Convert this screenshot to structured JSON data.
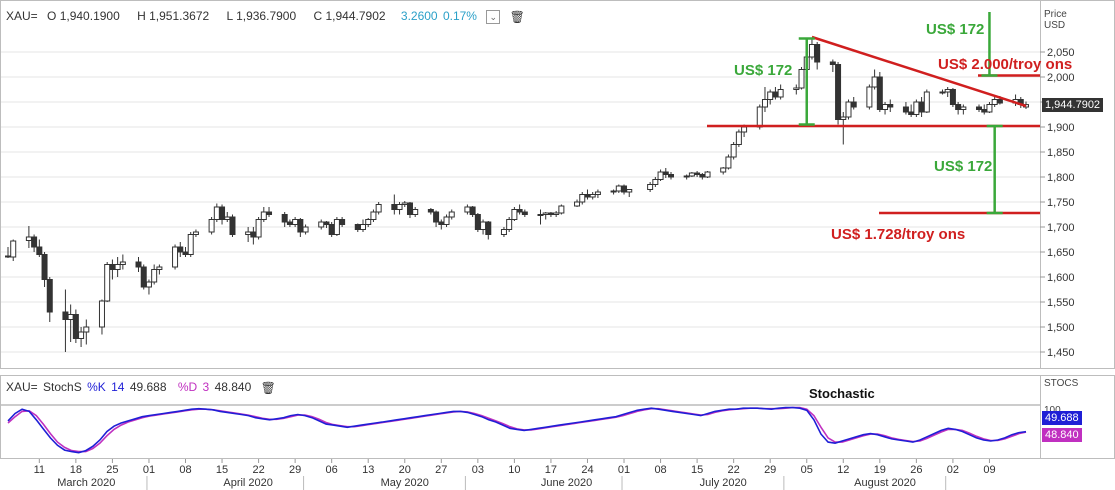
{
  "header": {
    "symbol": "XAU=",
    "open": "O 1,940.1900",
    "high": "H 1,951.3672",
    "low": "L 1,936.7900",
    "close": "C 1,944.7902",
    "change": "3.2600",
    "change_pct": "0.17%"
  },
  "stoch_header": {
    "symbol": "XAU=",
    "name": "StochS",
    "k_label": "%K",
    "k_period": "14",
    "k_value": "49.688",
    "d_label": "%D",
    "d_period": "3",
    "d_value": "48.840"
  },
  "price_axis": {
    "title_line1": "Price",
    "title_line2": "USD",
    "ticks": [
      "2,050",
      "2,000",
      "1,950",
      "1,900",
      "1,850",
      "1,800",
      "1,750",
      "1,700",
      "1,650",
      "1,600",
      "1,550",
      "1,500",
      "1,450"
    ],
    "last_price_label": "1,944.7902"
  },
  "stoch_axis": {
    "title": "STOCS",
    "tick": "100"
  },
  "x_axis": {
    "day_ticks": [
      "11",
      "18",
      "25",
      "01",
      "08",
      "15",
      "22",
      "29",
      "06",
      "13",
      "20",
      "27",
      "03",
      "10",
      "17",
      "24",
      "01",
      "08",
      "15",
      "22",
      "29",
      "05",
      "12",
      "19",
      "26",
      "02",
      "09"
    ],
    "month_labels": [
      "March 2020",
      "April 2020",
      "May 2020",
      "June 2020",
      "July 2020",
      "August 2020"
    ]
  },
  "annotations": {
    "label_172_top_right": "US$ 172",
    "label_172_left": "US$ 172",
    "label_172_bottom": "US$ 172",
    "target_high": "US$ 2.000/troy ons",
    "target_low": "US$ 1.728/troy ons",
    "stochastic": "Stochastic"
  },
  "colors": {
    "up_candle": "#ffffff",
    "down_candle": "#333333",
    "k_line": "#1f1fd6",
    "d_line": "#c030c0",
    "annotation_green": "#3aa83a",
    "annotation_red": "#d01f1f",
    "change_text": "#2aa0c8",
    "last_price_tag": "#333333"
  },
  "chart_data": {
    "type": "candlestick",
    "instrument": "XAU=",
    "y_range": [
      1440,
      2100
    ],
    "x_range": [
      "2020-03-05",
      "2020-08-14"
    ],
    "price_series": [
      [
        "2020-03-05",
        1642,
        1660,
        1638,
        1640
      ],
      [
        "2020-03-06",
        1640,
        1675,
        1632,
        1672
      ],
      [
        "2020-03-09",
        1673,
        1702,
        1658,
        1680
      ],
      [
        "2020-03-10",
        1680,
        1685,
        1650,
        1660
      ],
      [
        "2020-03-11",
        1660,
        1675,
        1640,
        1645
      ],
      [
        "2020-03-12",
        1645,
        1650,
        1580,
        1595
      ],
      [
        "2020-03-13",
        1595,
        1600,
        1510,
        1530
      ],
      [
        "2020-03-16",
        1530,
        1575,
        1450,
        1515
      ],
      [
        "2020-03-17",
        1515,
        1545,
        1470,
        1525
      ],
      [
        "2020-03-18",
        1525,
        1535,
        1468,
        1477
      ],
      [
        "2020-03-19",
        1477,
        1500,
        1460,
        1490
      ],
      [
        "2020-03-20",
        1490,
        1515,
        1465,
        1500
      ],
      [
        "2020-03-23",
        1500,
        1555,
        1485,
        1552
      ],
      [
        "2020-03-24",
        1552,
        1630,
        1550,
        1625
      ],
      [
        "2020-03-25",
        1625,
        1635,
        1595,
        1615
      ],
      [
        "2020-03-26",
        1615,
        1640,
        1600,
        1625
      ],
      [
        "2020-03-27",
        1625,
        1645,
        1615,
        1630
      ],
      [
        "2020-03-30",
        1630,
        1640,
        1610,
        1620
      ],
      [
        "2020-03-31",
        1620,
        1625,
        1575,
        1580
      ],
      [
        "2020-04-01",
        1580,
        1595,
        1565,
        1590
      ],
      [
        "2020-04-02",
        1590,
        1625,
        1585,
        1615
      ],
      [
        "2020-04-03",
        1615,
        1625,
        1605,
        1620
      ],
      [
        "2020-04-06",
        1620,
        1665,
        1615,
        1660
      ],
      [
        "2020-04-07",
        1660,
        1670,
        1640,
        1650
      ],
      [
        "2020-04-08",
        1650,
        1660,
        1640,
        1645
      ],
      [
        "2020-04-09",
        1645,
        1690,
        1640,
        1685
      ],
      [
        "2020-04-10",
        1685,
        1695,
        1680,
        1690
      ],
      [
        "2020-04-13",
        1690,
        1720,
        1685,
        1715
      ],
      [
        "2020-04-14",
        1715,
        1747,
        1710,
        1740
      ],
      [
        "2020-04-15",
        1740,
        1745,
        1705,
        1715
      ],
      [
        "2020-04-16",
        1715,
        1730,
        1710,
        1720
      ],
      [
        "2020-04-17",
        1720,
        1725,
        1680,
        1685
      ],
      [
        "2020-04-20",
        1685,
        1700,
        1670,
        1690
      ],
      [
        "2020-04-21",
        1690,
        1700,
        1665,
        1680
      ],
      [
        "2020-04-22",
        1680,
        1720,
        1675,
        1715
      ],
      [
        "2020-04-23",
        1715,
        1740,
        1710,
        1730
      ],
      [
        "2020-04-24",
        1730,
        1740,
        1720,
        1725
      ],
      [
        "2020-04-27",
        1725,
        1730,
        1700,
        1710
      ],
      [
        "2020-04-28",
        1710,
        1715,
        1700,
        1705
      ],
      [
        "2020-04-29",
        1705,
        1720,
        1700,
        1715
      ],
      [
        "2020-04-30",
        1715,
        1718,
        1680,
        1690
      ],
      [
        "2020-05-01",
        1690,
        1705,
        1685,
        1700
      ],
      [
        "2020-05-04",
        1700,
        1715,
        1695,
        1710
      ],
      [
        "2020-05-05",
        1710,
        1712,
        1698,
        1705
      ],
      [
        "2020-05-06",
        1705,
        1710,
        1680,
        1685
      ],
      [
        "2020-05-07",
        1685,
        1720,
        1682,
        1715
      ],
      [
        "2020-05-08",
        1715,
        1720,
        1700,
        1705
      ],
      [
        "2020-05-11",
        1705,
        1707,
        1690,
        1695
      ],
      [
        "2020-05-12",
        1695,
        1715,
        1690,
        1705
      ],
      [
        "2020-05-13",
        1705,
        1718,
        1700,
        1715
      ],
      [
        "2020-05-14",
        1715,
        1735,
        1710,
        1730
      ],
      [
        "2020-05-15",
        1730,
        1750,
        1725,
        1745
      ],
      [
        "2020-05-18",
        1745,
        1765,
        1725,
        1735
      ],
      [
        "2020-05-19",
        1735,
        1750,
        1725,
        1745
      ],
      [
        "2020-05-20",
        1745,
        1752,
        1740,
        1748
      ],
      [
        "2020-05-21",
        1748,
        1750,
        1718,
        1725
      ],
      [
        "2020-05-22",
        1725,
        1740,
        1720,
        1735
      ],
      [
        "2020-05-25",
        1735,
        1738,
        1725,
        1730
      ],
      [
        "2020-05-26",
        1730,
        1733,
        1700,
        1710
      ],
      [
        "2020-05-27",
        1710,
        1715,
        1695,
        1705
      ],
      [
        "2020-05-28",
        1705,
        1725,
        1700,
        1720
      ],
      [
        "2020-05-29",
        1720,
        1735,
        1715,
        1730
      ],
      [
        "2020-06-01",
        1730,
        1745,
        1725,
        1740
      ],
      [
        "2020-06-02",
        1740,
        1742,
        1720,
        1725
      ],
      [
        "2020-06-03",
        1725,
        1728,
        1690,
        1695
      ],
      [
        "2020-06-04",
        1695,
        1715,
        1685,
        1710
      ],
      [
        "2020-06-05",
        1710,
        1712,
        1675,
        1685
      ],
      [
        "2020-06-08",
        1685,
        1700,
        1680,
        1695
      ],
      [
        "2020-06-09",
        1695,
        1720,
        1690,
        1715
      ],
      [
        "2020-06-10",
        1715,
        1740,
        1712,
        1735
      ],
      [
        "2020-06-11",
        1735,
        1745,
        1725,
        1730
      ],
      [
        "2020-06-12",
        1730,
        1735,
        1720,
        1725
      ],
      [
        "2020-06-15",
        1725,
        1735,
        1705,
        1725
      ],
      [
        "2020-06-16",
        1725,
        1730,
        1715,
        1728
      ],
      [
        "2020-06-17",
        1728,
        1730,
        1720,
        1725
      ],
      [
        "2020-06-18",
        1725,
        1732,
        1720,
        1728
      ],
      [
        "2020-06-19",
        1728,
        1745,
        1725,
        1742
      ],
      [
        "2020-06-22",
        1742,
        1755,
        1740,
        1750
      ],
      [
        "2020-06-23",
        1750,
        1770,
        1745,
        1765
      ],
      [
        "2020-06-24",
        1765,
        1775,
        1755,
        1760
      ],
      [
        "2020-06-25",
        1760,
        1770,
        1755,
        1765
      ],
      [
        "2020-06-26",
        1765,
        1775,
        1758,
        1770
      ],
      [
        "2020-06-29",
        1770,
        1775,
        1765,
        1772
      ],
      [
        "2020-06-30",
        1772,
        1785,
        1768,
        1782
      ],
      [
        "2020-07-01",
        1782,
        1785,
        1765,
        1770
      ],
      [
        "2020-07-02",
        1770,
        1775,
        1760,
        1775
      ],
      [
        "2020-07-06",
        1775,
        1790,
        1770,
        1785
      ],
      [
        "2020-07-07",
        1785,
        1800,
        1780,
        1795
      ],
      [
        "2020-07-08",
        1795,
        1815,
        1792,
        1810
      ],
      [
        "2020-07-09",
        1810,
        1818,
        1798,
        1805
      ],
      [
        "2020-07-10",
        1805,
        1810,
        1795,
        1800
      ],
      [
        "2020-07-13",
        1800,
        1805,
        1795,
        1802
      ],
      [
        "2020-07-14",
        1802,
        1810,
        1800,
        1808
      ],
      [
        "2020-07-15",
        1808,
        1812,
        1800,
        1805
      ],
      [
        "2020-07-16",
        1805,
        1808,
        1795,
        1800
      ],
      [
        "2020-07-17",
        1800,
        1812,
        1798,
        1810
      ],
      [
        "2020-07-20",
        1810,
        1820,
        1805,
        1818
      ],
      [
        "2020-07-21",
        1818,
        1845,
        1815,
        1840
      ],
      [
        "2020-07-22",
        1840,
        1870,
        1835,
        1865
      ],
      [
        "2020-07-23",
        1865,
        1895,
        1860,
        1890
      ],
      [
        "2020-07-24",
        1890,
        1905,
        1880,
        1900
      ],
      [
        "2020-07-27",
        1900,
        1945,
        1895,
        1940
      ],
      [
        "2020-07-28",
        1940,
        1980,
        1930,
        1955
      ],
      [
        "2020-07-29",
        1955,
        1975,
        1945,
        1970
      ],
      [
        "2020-07-30",
        1970,
        1980,
        1955,
        1960
      ],
      [
        "2020-07-31",
        1960,
        1985,
        1955,
        1975
      ],
      [
        "2020-08-03",
        1975,
        1985,
        1965,
        1978
      ],
      [
        "2020-08-04",
        1978,
        2020,
        1975,
        2015
      ],
      [
        "2020-08-05",
        2015,
        2055,
        2010,
        2040
      ],
      [
        "2020-08-06",
        2040,
        2075,
        2035,
        2065
      ],
      [
        "2020-08-07",
        2065,
        2070,
        2015,
        2030
      ],
      [
        "2020-08-10",
        2030,
        2035,
        2010,
        2025
      ],
      [
        "2020-08-11",
        2025,
        2030,
        1905,
        1915
      ],
      [
        "2020-08-12",
        1915,
        1930,
        1865,
        1920
      ],
      [
        "2020-08-13",
        1920,
        1955,
        1915,
        1950
      ],
      [
        "2020-08-14",
        1950,
        1960,
        1935,
        1940
      ],
      [
        "2020-08-17",
        1940,
        1985,
        1935,
        1980
      ],
      [
        "2020-08-18",
        1980,
        2015,
        1975,
        2000
      ],
      [
        "2020-08-19",
        2000,
        2010,
        1930,
        1935
      ],
      [
        "2020-08-20",
        1935,
        1950,
        1925,
        1945
      ],
      [
        "2020-08-21",
        1945,
        1955,
        1930,
        1940
      ],
      [
        "2020-08-24",
        1940,
        1950,
        1925,
        1930
      ],
      [
        "2020-08-25",
        1930,
        1945,
        1920,
        1925
      ],
      [
        "2020-08-26",
        1925,
        1955,
        1920,
        1950
      ],
      [
        "2020-08-27",
        1950,
        1960,
        1920,
        1930
      ],
      [
        "2020-08-28",
        1930,
        1975,
        1928,
        1970
      ],
      [
        "2020-08-31",
        1970,
        1975,
        1965,
        1970
      ],
      [
        "2020-09-01",
        1970,
        1980,
        1960,
        1975
      ],
      [
        "2020-09-02",
        1975,
        1978,
        1940,
        1945
      ],
      [
        "2020-09-03",
        1945,
        1950,
        1925,
        1935
      ],
      [
        "2020-09-04",
        1935,
        1945,
        1925,
        1940
      ],
      [
        "2020-09-07",
        1940,
        1945,
        1930,
        1935
      ],
      [
        "2020-09-08",
        1935,
        1945,
        1925,
        1930
      ],
      [
        "2020-09-09",
        1930,
        1950,
        1928,
        1945
      ],
      [
        "2020-09-10",
        1945,
        1960,
        1940,
        1955
      ],
      [
        "2020-09-11",
        1955,
        1962,
        1945,
        1948
      ],
      [
        "2020-09-14",
        1948,
        1965,
        1942,
        1955
      ],
      [
        "2020-09-15",
        1955,
        1960,
        1938,
        1945
      ],
      [
        "2020-09-16",
        1940,
        1951,
        1936,
        1944.79
      ]
    ],
    "stoch_k": [
      70,
      84,
      92,
      88,
      72,
      55,
      38,
      24,
      15,
      12,
      10,
      14,
      22,
      34,
      50,
      60,
      66,
      70,
      74,
      78,
      80,
      82,
      84,
      86,
      88,
      90,
      92,
      93,
      92,
      91,
      88,
      86,
      84,
      82,
      80,
      76,
      74,
      72,
      74,
      76,
      80,
      82,
      80,
      76,
      70,
      64,
      62,
      60,
      58,
      60,
      62,
      64,
      66,
      68,
      70,
      72,
      74,
      76,
      78,
      80,
      82,
      84,
      86,
      88,
      88,
      86,
      82,
      78,
      72,
      68,
      62,
      56,
      54,
      52,
      54,
      56,
      58,
      60,
      62,
      64,
      66,
      68,
      70,
      72,
      74,
      76,
      78,
      82,
      86,
      90,
      92,
      94,
      92,
      90,
      88,
      86,
      84,
      82,
      80,
      84,
      88,
      90,
      92,
      92,
      94,
      94,
      94,
      93,
      92,
      94,
      95,
      95,
      94,
      90,
      72,
      45,
      30,
      28,
      32,
      36,
      40,
      44,
      46,
      44,
      40,
      36,
      34,
      32,
      30,
      34,
      40,
      46,
      52,
      56,
      54,
      50,
      44,
      38,
      34,
      32,
      34,
      38,
      44,
      48,
      49.688
    ],
    "stoch_d": [
      66,
      78,
      88,
      89,
      80,
      64,
      46,
      30,
      20,
      14,
      12,
      12,
      18,
      28,
      42,
      54,
      62,
      68,
      72,
      76,
      79,
      81,
      83,
      85,
      87,
      89,
      91,
      92,
      92,
      91,
      89,
      87,
      85,
      83,
      81,
      78,
      75,
      73,
      73,
      75,
      78,
      81,
      81,
      78,
      73,
      67,
      63,
      61,
      59,
      59,
      61,
      63,
      65,
      67,
      69,
      71,
      73,
      75,
      77,
      79,
      81,
      83,
      85,
      87,
      88,
      87,
      84,
      80,
      75,
      70,
      65,
      59,
      55,
      53,
      53,
      55,
      57,
      59,
      61,
      63,
      65,
      67,
      69,
      71,
      73,
      75,
      77,
      80,
      84,
      88,
      91,
      93,
      93,
      91,
      89,
      87,
      85,
      83,
      81,
      82,
      86,
      89,
      91,
      92,
      93,
      94,
      94,
      93,
      93,
      93,
      94,
      95,
      95,
      92,
      80,
      58,
      38,
      30,
      30,
      34,
      38,
      42,
      45,
      45,
      42,
      38,
      35,
      33,
      31,
      32,
      37,
      43,
      49,
      54,
      54,
      52,
      47,
      41,
      36,
      33,
      33,
      36,
      41,
      46,
      48.84
    ],
    "stoch_y_range": [
      0,
      100
    ],
    "horizontal_lines": {
      "support": 1902,
      "target_low": 1728,
      "target_high": 2003
    },
    "trendline": {
      "start": [
        "2020-08-06",
        2080
      ],
      "end": [
        "2020-09-16",
        1942
      ]
    },
    "measure_bars": [
      {
        "x": "2020-08-05",
        "from": 1905,
        "to": 2077
      },
      {
        "x": "2020-09-10",
        "from": 1902,
        "to": 1728
      },
      {
        "x": "2020-09-09",
        "from": 2003,
        "to": 2130
      }
    ]
  }
}
